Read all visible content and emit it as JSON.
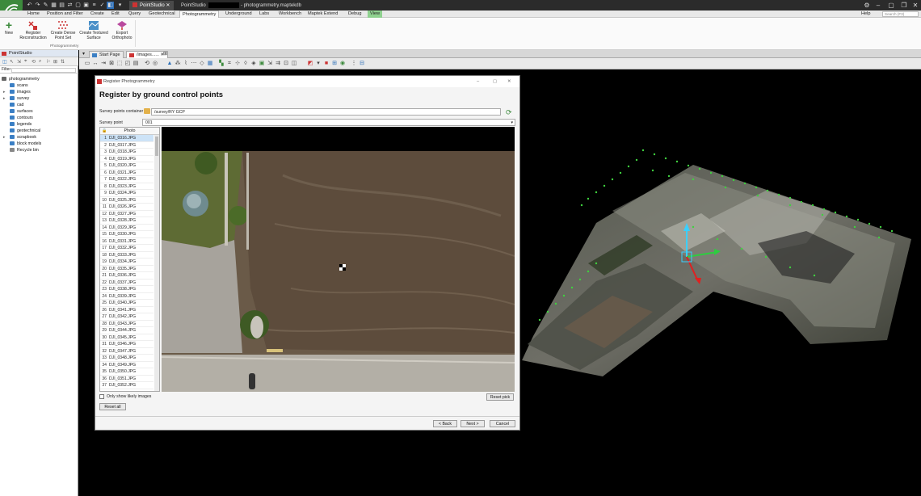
{
  "titlebar": {
    "active_tab": "PointStudio",
    "second_tab": "PointStudio",
    "document": "- photogrammetry.maptekdb"
  },
  "ribbon": {
    "tabs": [
      "Home",
      "Position and Filter",
      "Create",
      "Edit",
      "Query",
      "Geotechnical",
      "Photogrammetry",
      "Underground",
      "Labs",
      "Workbench",
      "Maptek Extend",
      "Debug",
      "View"
    ],
    "active_tab": "Photogrammetry",
    "help": "Help",
    "search_placeholder": "Search (F3)",
    "buttons": [
      {
        "label1": "New",
        "label2": ""
      },
      {
        "label1": "Register",
        "label2": "Reconstruction"
      },
      {
        "label1": "Create Dense",
        "label2": "Point Set"
      },
      {
        "label1": "Create Textured",
        "label2": "Surface"
      },
      {
        "label1": "Export",
        "label2": "Orthophoto"
      }
    ],
    "group_label": "Photogrammetry"
  },
  "left_panel": {
    "title": "PointStudio",
    "filter_label": "Filter",
    "root": "photogrammetry",
    "items": [
      "scans",
      "images",
      "survey",
      "cad",
      "surfaces",
      "contours",
      "legends",
      "geotechnical",
      "scrapbook",
      "block models",
      "Recycle bin"
    ]
  },
  "doc_tabs": [
    "Start Page",
    "/images......"
  ],
  "dialog": {
    "title": "Register Photogrammetry",
    "heading": "Register by ground control points",
    "container_label": "Survey points container",
    "container_value": "/survey/RY GCP",
    "point_label": "Survey point",
    "point_value": "001",
    "photo_header": "Photo",
    "photos": [
      "DJI_0316.JPG",
      "DJI_0317.JPG",
      "DJI_0318.JPG",
      "DJI_0319.JPG",
      "DJI_0320.JPG",
      "DJI_0321.JPG",
      "DJI_0322.JPG",
      "DJI_0323.JPG",
      "DJI_0324.JPG",
      "DJI_0325.JPG",
      "DJI_0326.JPG",
      "DJI_0327.JPG",
      "DJI_0328.JPG",
      "DJI_0329.JPG",
      "DJI_0330.JPG",
      "DJI_0331.JPG",
      "DJI_0332.JPG",
      "DJI_0333.JPG",
      "DJI_0334.JPG",
      "DJI_0335.JPG",
      "DJI_0336.JPG",
      "DJI_0337.JPG",
      "DJI_0338.JPG",
      "DJI_0339.JPG",
      "DJI_0340.JPG",
      "DJI_0341.JPG",
      "DJI_0342.JPG",
      "DJI_0343.JPG",
      "DJI_0344.JPG",
      "DJI_0345.JPG",
      "DJI_0346.JPG",
      "DJI_0347.JPG",
      "DJI_0348.JPG",
      "DJI_0349.JPG",
      "DJI_0350.JPG",
      "DJI_0351.JPG",
      "DJI_0352.JPG"
    ],
    "likely_label": "Only show likely images",
    "reset_pick": "Reset pick",
    "reset_all": "Reset all",
    "back": "< Back",
    "next": "Next >",
    "cancel": "Cancel"
  },
  "colors": {
    "accent_green": "#3c8a3c",
    "view_tab": "#8fd18f",
    "selection": "#cde3f7"
  }
}
